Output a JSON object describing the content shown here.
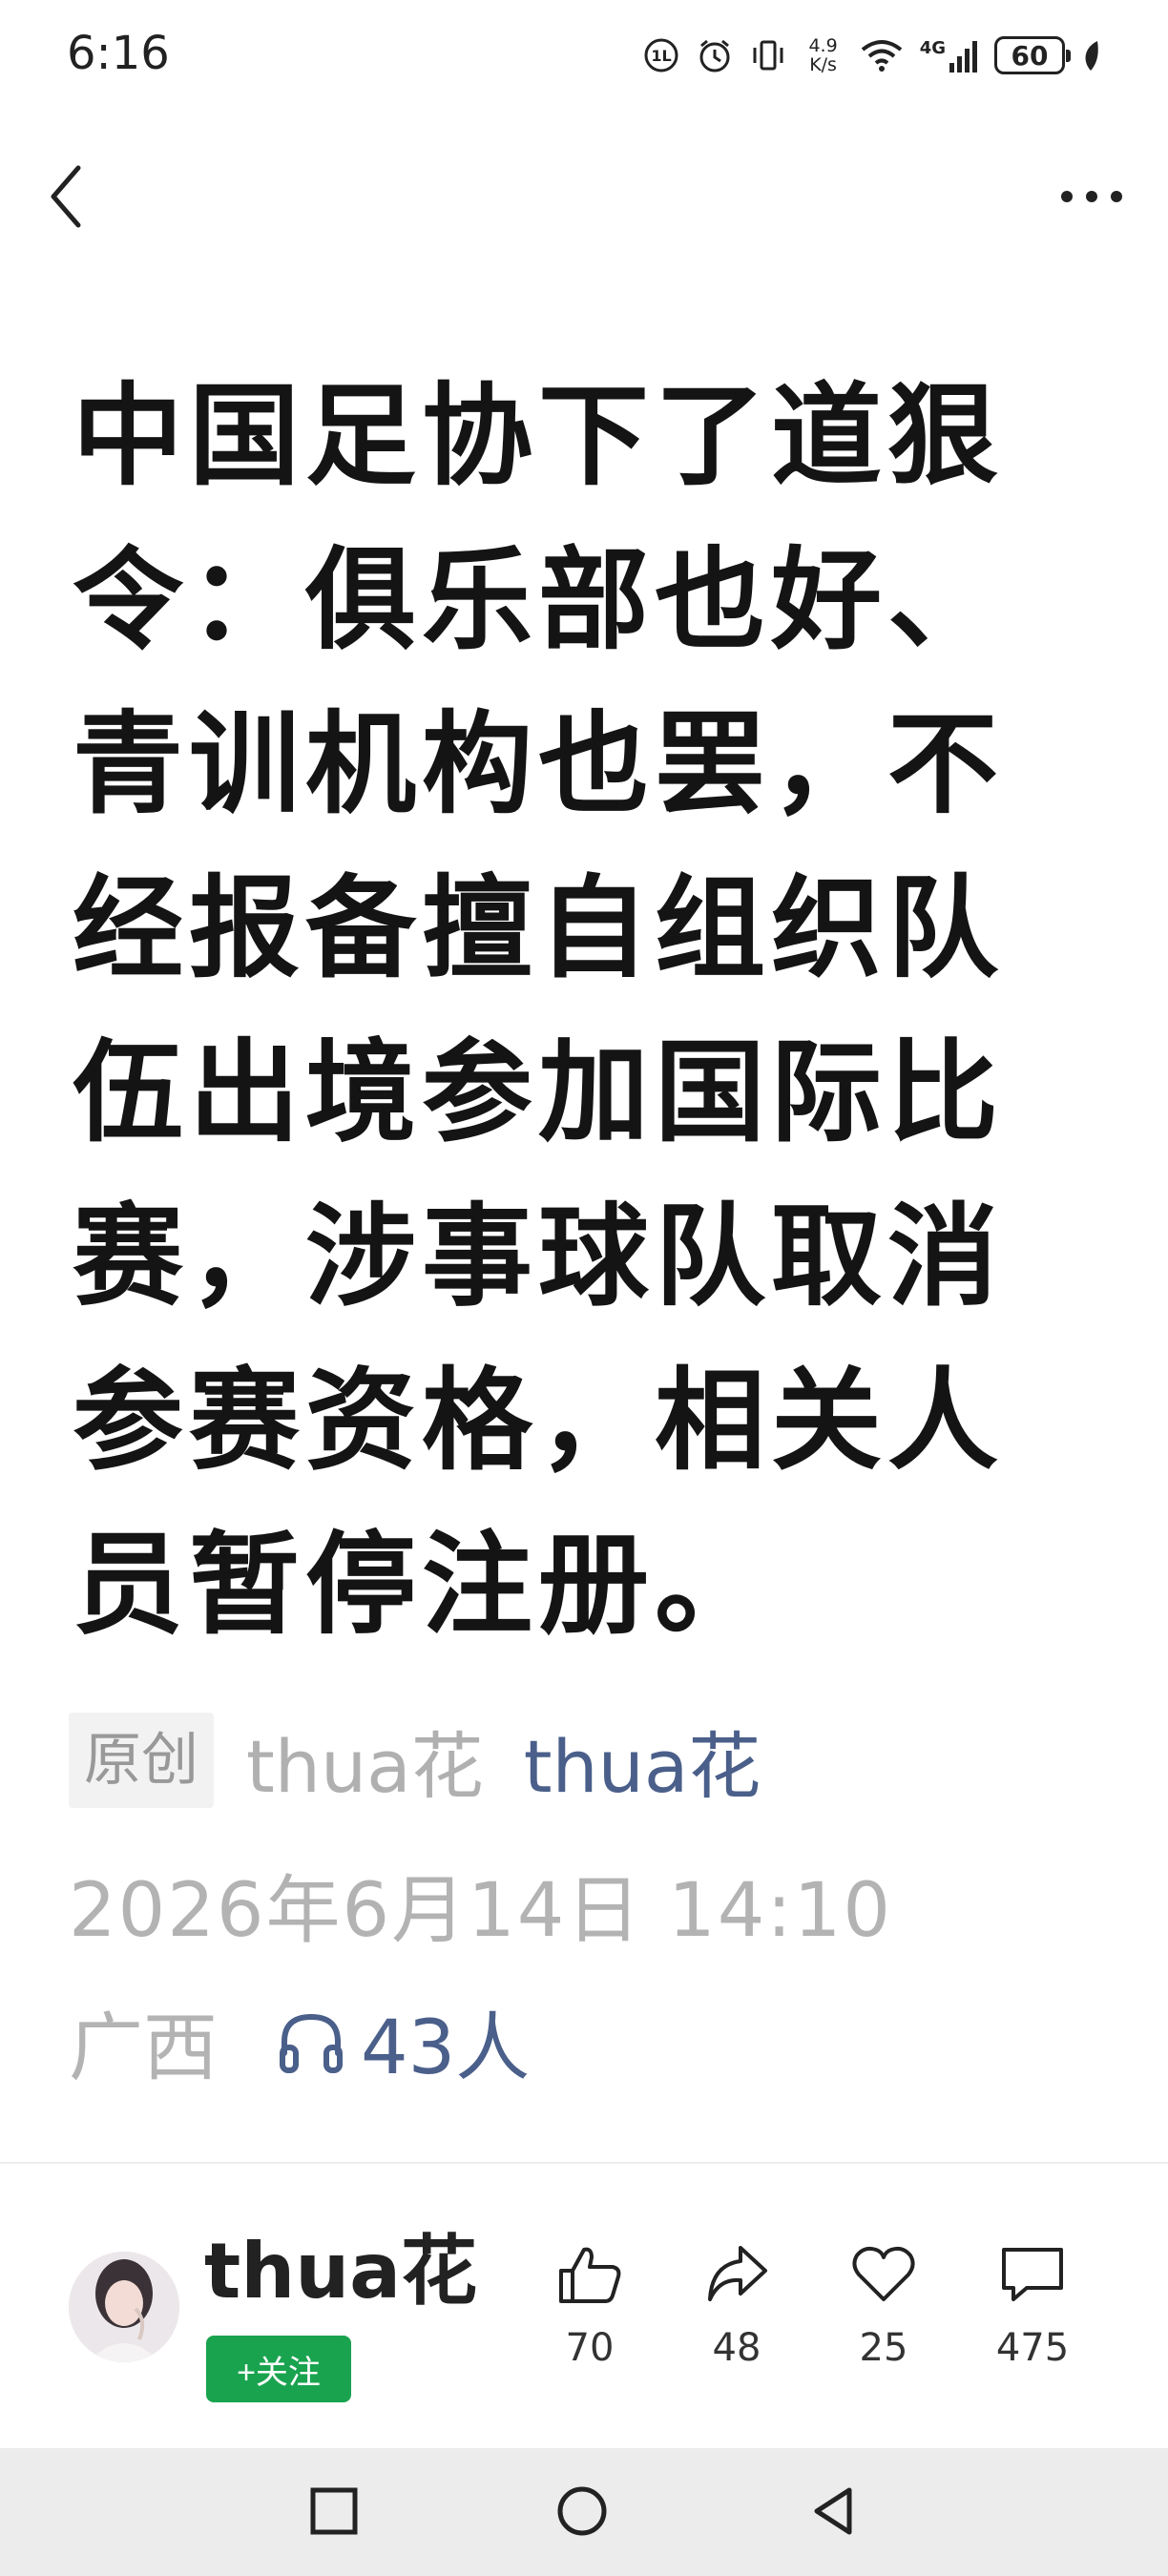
{
  "status_bar": {
    "time": "6:16",
    "net_speed_value": "4.9",
    "net_speed_unit": "K/s",
    "network_type": "4G",
    "battery": "60"
  },
  "nav": {
    "back_icon": "chevron-left-icon",
    "more_icon": "more-horizontal-icon"
  },
  "article": {
    "title": "中国足协下了道狠令：俱乐部也好、青训机构也罢，不经报备擅自组织队伍出境参加国际比赛，涉事球队取消参赛资格，相关人员暂停注册。",
    "original_badge": "原创",
    "source": "thua花",
    "author": "thua花",
    "date": "2026年6月14日 14:10",
    "location": "广西",
    "listen_count": "43人"
  },
  "author_bar": {
    "name": "thua花",
    "follow_label": "+关注",
    "actions": [
      {
        "icon": "thumbs-up-icon",
        "count": "70"
      },
      {
        "icon": "share-icon",
        "count": "48"
      },
      {
        "icon": "heart-icon",
        "count": "25"
      },
      {
        "icon": "comment-icon",
        "count": "475"
      }
    ]
  },
  "colors": {
    "accent_link": "#4a5f8a",
    "follow_green": "#1aa34f",
    "meta_gray": "#b3b3b3"
  }
}
